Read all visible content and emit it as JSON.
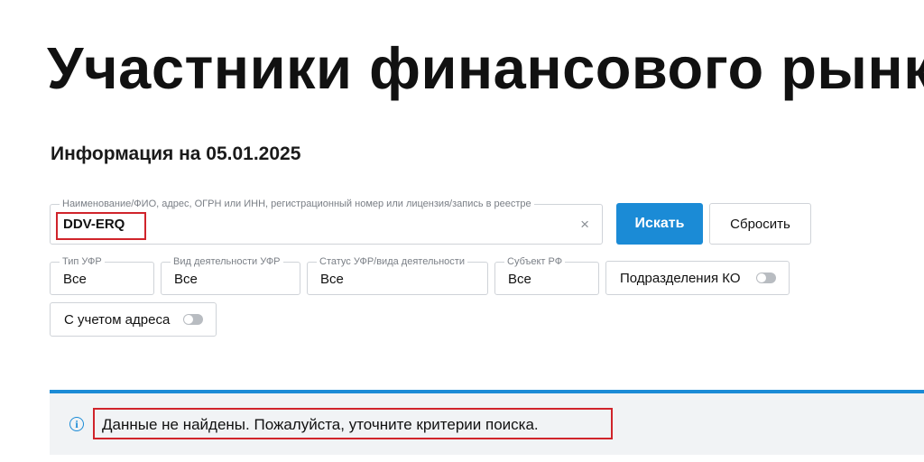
{
  "header": {
    "title": "Участники финансового рынка"
  },
  "info": {
    "date_label": "Информация на 05.01.2025"
  },
  "search": {
    "legend": "Наименование/ФИО, адрес, ОГРН или ИНН, регистрационный номер или лицензия/запись в реестре",
    "value": "DDV-ERQ",
    "clear_icon": "×",
    "submit_label": "Искать",
    "reset_label": "Сбросить"
  },
  "filters": {
    "type": {
      "legend": "Тип УФР",
      "value": "Все"
    },
    "activity": {
      "legend": "Вид деятельности УФР",
      "value": "Все"
    },
    "status": {
      "legend": "Статус УФР/вида деятельности",
      "value": "Все"
    },
    "region": {
      "legend": "Субъект РФ",
      "value": "Все"
    }
  },
  "toggles": {
    "ko_divisions": {
      "label": "Подразделения КО",
      "on": false
    },
    "with_address": {
      "label": "С учетом адреса",
      "on": false
    }
  },
  "alert": {
    "icon": "i",
    "message": "Данные не найдены. Пожалуйста, уточните критерии поиска."
  },
  "colors": {
    "accent": "#1b8bd6",
    "highlight": "#d0242b",
    "alert_bg": "#f1f3f5"
  }
}
